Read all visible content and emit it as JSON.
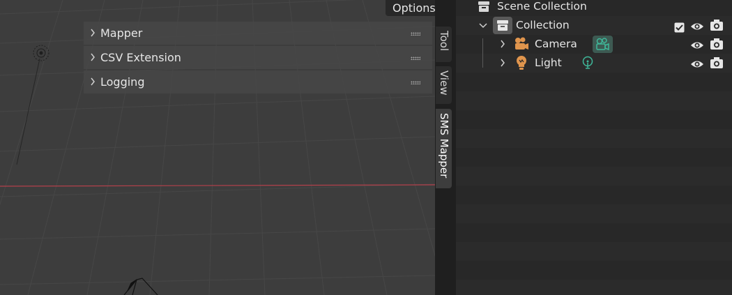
{
  "viewport": {
    "options_label": "Options",
    "panels": [
      {
        "label": "Mapper"
      },
      {
        "label": "CSV Extension"
      },
      {
        "label": "Logging"
      }
    ]
  },
  "sidebar_tabs": [
    {
      "label": "Tool",
      "active": false
    },
    {
      "label": "View",
      "active": false
    },
    {
      "label": "SMS Mapper",
      "active": true
    }
  ],
  "outliner": {
    "scene_collection": "Scene Collection",
    "collection": "Collection",
    "objects": [
      {
        "label": "Camera",
        "icon": "camera-object-icon",
        "data_icon": "camera-data-icon"
      },
      {
        "label": "Light",
        "icon": "light-object-icon",
        "data_icon": "light-data-icon"
      }
    ]
  },
  "colors": {
    "accent_orange": "#e0954d",
    "data_green": "#3fb89a",
    "axis_red": "#c2434f"
  }
}
